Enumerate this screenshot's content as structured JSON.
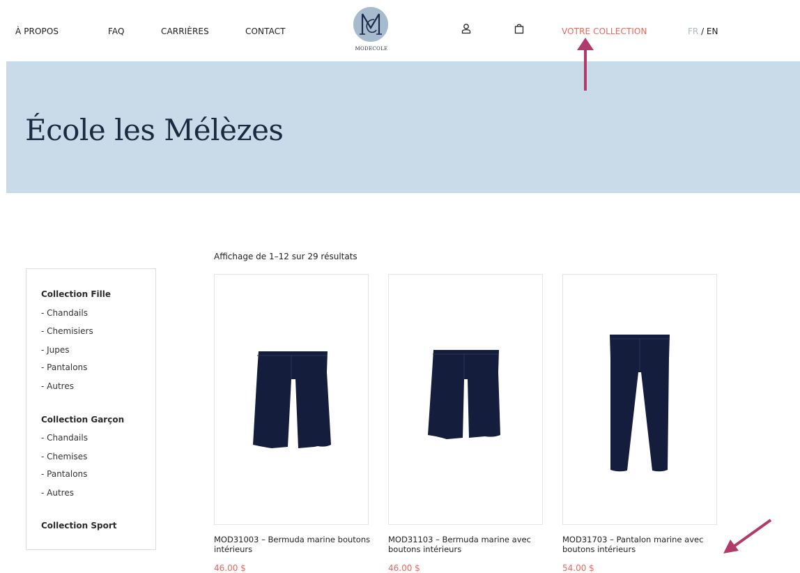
{
  "nav": {
    "about": "À PROPOS",
    "faq": "FAQ",
    "careers": "CARRIÈRES",
    "contact": "CONTACT",
    "logo_text": "MODECOLE",
    "account_icon": "user-icon",
    "cart_icon": "shopping-bag-icon",
    "collection": "VOTRE COLLECTION",
    "lang_fr": "FR",
    "lang_sep": " / ",
    "lang_en": "EN"
  },
  "hero": {
    "title": "École les Mélèzes"
  },
  "sidebar": {
    "groups": [
      {
        "title": "Collection Fille",
        "items": [
          "- Chandails",
          "- Chemisiers",
          "- Jupes",
          "- Pantalons",
          "- Autres"
        ]
      },
      {
        "title": "Collection Garçon",
        "items": [
          "- Chandails",
          "- Chemises",
          "- Pantalons",
          "- Autres"
        ]
      },
      {
        "title": "Collection Sport",
        "items": []
      }
    ]
  },
  "results_text": "Affichage de 1–12 sur 29 résultats",
  "products": [
    {
      "title": "MOD31003 – Bermuda marine boutons intérieurs",
      "price": "46.00 $",
      "image": "navy-bermuda-shorts"
    },
    {
      "title": "MOD31103 – Bermuda marine avec boutons intérieurs",
      "price": "46.00 $",
      "image": "navy-bermuda-shorts"
    },
    {
      "title": "MOD31703 – Pantalon marine avec boutons intérieurs",
      "price": "54.00 $",
      "image": "navy-trousers"
    }
  ],
  "colors": {
    "accent": "#e8665c",
    "hero_bg": "#c9dbe8",
    "navy": "#141d3b",
    "annotation_arrow": "#b23a6b"
  }
}
